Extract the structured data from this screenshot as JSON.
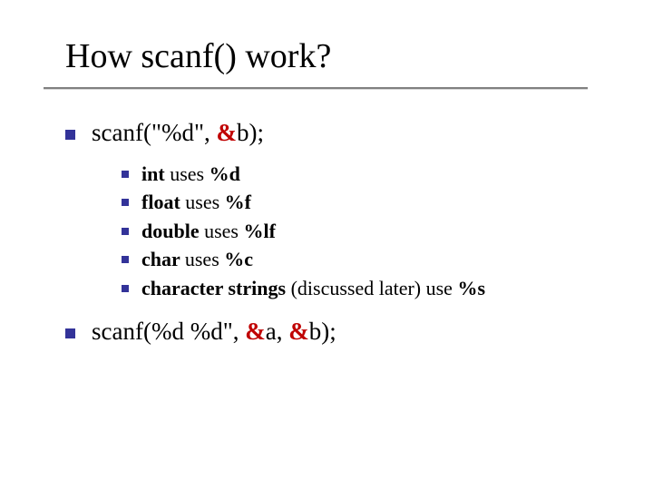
{
  "title": "How scanf() work?",
  "line1": {
    "pre": "scanf(\"%d\", ",
    "amp": "&",
    "post": "b);"
  },
  "sub": [
    {
      "b1": "int ",
      "t1": "uses ",
      "b2": "%d"
    },
    {
      "b1": "float ",
      "t1": "uses ",
      "b2": "%f"
    },
    {
      "b1": "double ",
      "t1": "uses ",
      "b2": "%lf"
    },
    {
      "b1": "char ",
      "t1": "uses ",
      "b2": "%c"
    },
    {
      "b1": "character strings ",
      "t1": "(discussed later) use ",
      "b2": "%s"
    }
  ],
  "line2": {
    "pre": "scanf(%d   %d\", ",
    "a1": "&",
    "t1": "a, ",
    "a2": "&",
    "t2": "b);"
  }
}
